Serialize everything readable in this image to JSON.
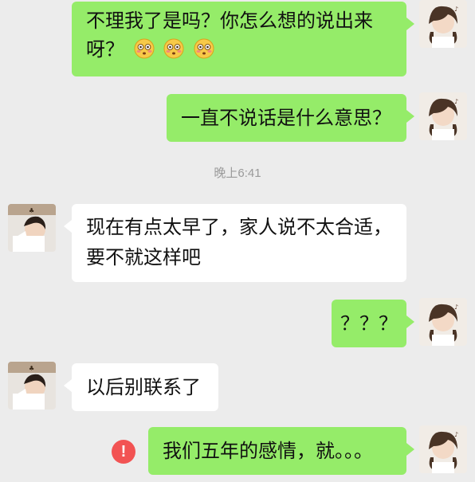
{
  "messages": {
    "m1": {
      "line1": "不理我了是吗？你怎么想的说出来",
      "line2": "呀？",
      "emoji": "flushed-face-emoji"
    },
    "m2": {
      "text": "一直不说话是什么意思？"
    },
    "timestamp": "晚上6:41",
    "m3": {
      "line1": "现在有点太早了，家人说不太合适，",
      "line2": "要不就这样吧"
    },
    "m4": {
      "text": "？？？"
    },
    "m5": {
      "text": "以后别联系了"
    },
    "m6": {
      "text": "我们五年的感情，就。。。",
      "fail_mark": "!"
    }
  },
  "colors": {
    "background": "#ececec",
    "my_bubble": "#95ec69",
    "their_bubble": "#ffffff",
    "fail_icon": "#f25353"
  }
}
